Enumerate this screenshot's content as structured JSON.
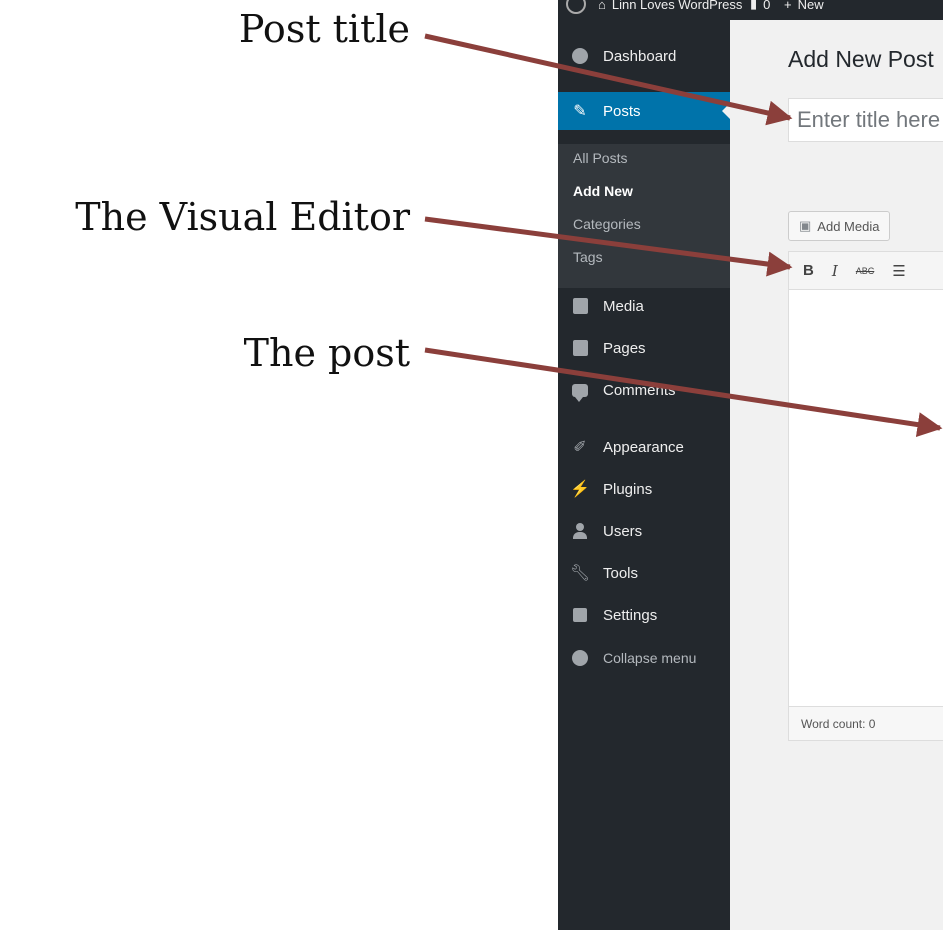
{
  "annotations": {
    "post_title": "Post title",
    "visual_editor": "The Visual Editor",
    "the_post": "The post"
  },
  "admin_bar": {
    "site_name": "Linn Loves WordPress",
    "comments_count": "0",
    "new_label": "New"
  },
  "sidebar": {
    "items": [
      {
        "label": "Dashboard",
        "icon": "dashboard-icon"
      },
      {
        "label": "Posts",
        "icon": "pin-icon"
      },
      {
        "label": "Media",
        "icon": "media-icon"
      },
      {
        "label": "Pages",
        "icon": "pages-icon"
      },
      {
        "label": "Comments",
        "icon": "comments-icon"
      },
      {
        "label": "Appearance",
        "icon": "brush-icon"
      },
      {
        "label": "Plugins",
        "icon": "plug-icon"
      },
      {
        "label": "Users",
        "icon": "user-icon"
      },
      {
        "label": "Tools",
        "icon": "wrench-icon"
      },
      {
        "label": "Settings",
        "icon": "settings-icon"
      },
      {
        "label": "Collapse menu",
        "icon": "collapse-icon"
      }
    ],
    "submenu": [
      "All Posts",
      "Add New",
      "Categories",
      "Tags"
    ]
  },
  "main": {
    "page_title": "Add New Post",
    "title_placeholder": "Enter title here",
    "add_media": "Add Media",
    "toolbar": {
      "bold": "B",
      "italic": "I",
      "strike": "ABC",
      "list": "☰"
    },
    "word_count": "Word count: 0"
  },
  "colors": {
    "sidebar": "#23282d",
    "active": "#0073aa",
    "arrow": "#8b3f3b"
  }
}
